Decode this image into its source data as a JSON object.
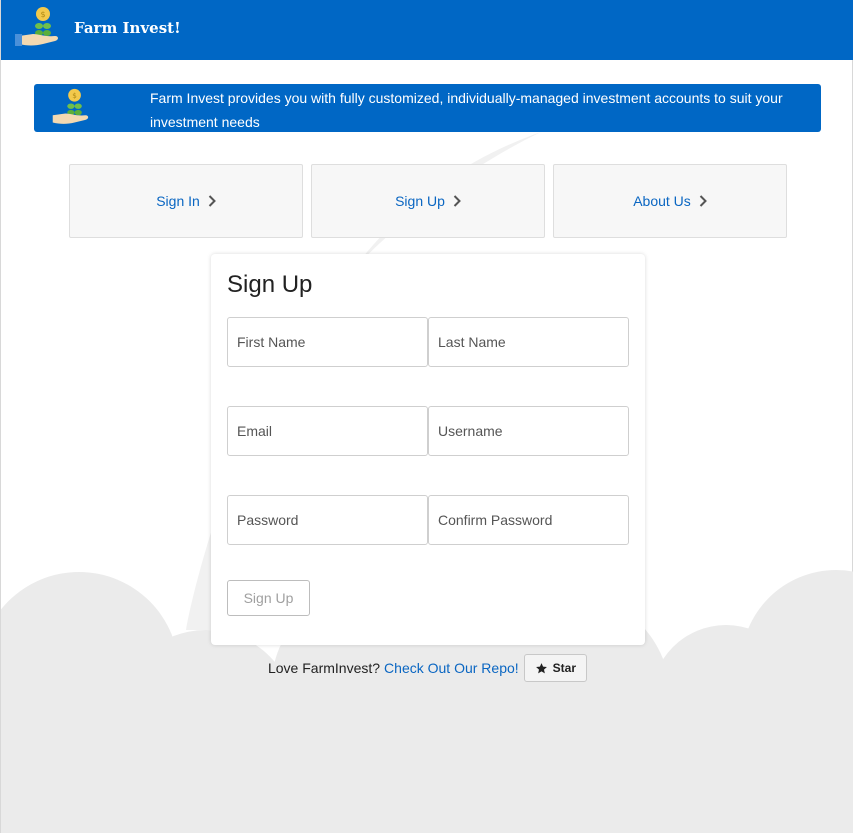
{
  "header": {
    "app_title": "Farm Invest!",
    "logo_icon": "money-hand-icon",
    "background_color": "#0067c5"
  },
  "banner": {
    "text": "Farm Invest provides you with fully customized, individually-managed investment accounts to suit your investment needs",
    "icon": "money-hand-icon"
  },
  "nav": {
    "items": [
      {
        "label": "Sign In",
        "icon": "chevron-right-icon"
      },
      {
        "label": "Sign Up",
        "icon": "chevron-right-icon"
      },
      {
        "label": "About Us",
        "icon": "chevron-right-icon"
      }
    ]
  },
  "signup_form": {
    "heading": "Sign Up",
    "fields": {
      "first_name": {
        "placeholder": "First Name",
        "value": ""
      },
      "last_name": {
        "placeholder": "Last Name",
        "value": ""
      },
      "email": {
        "placeholder": "Email",
        "value": ""
      },
      "username": {
        "placeholder": "Username",
        "value": ""
      },
      "password": {
        "placeholder": "Password",
        "value": ""
      },
      "confirm_password": {
        "placeholder": "Confirm Password",
        "value": ""
      }
    },
    "submit_label": "Sign Up"
  },
  "footer": {
    "text": "Love FarmInvest?",
    "link_label": "Check Out Our Repo!",
    "star_label": "Star",
    "star_icon": "star-icon"
  },
  "colors": {
    "primary": "#0067c5",
    "link": "#0a66c2",
    "background_shape": "#ebebeb"
  }
}
